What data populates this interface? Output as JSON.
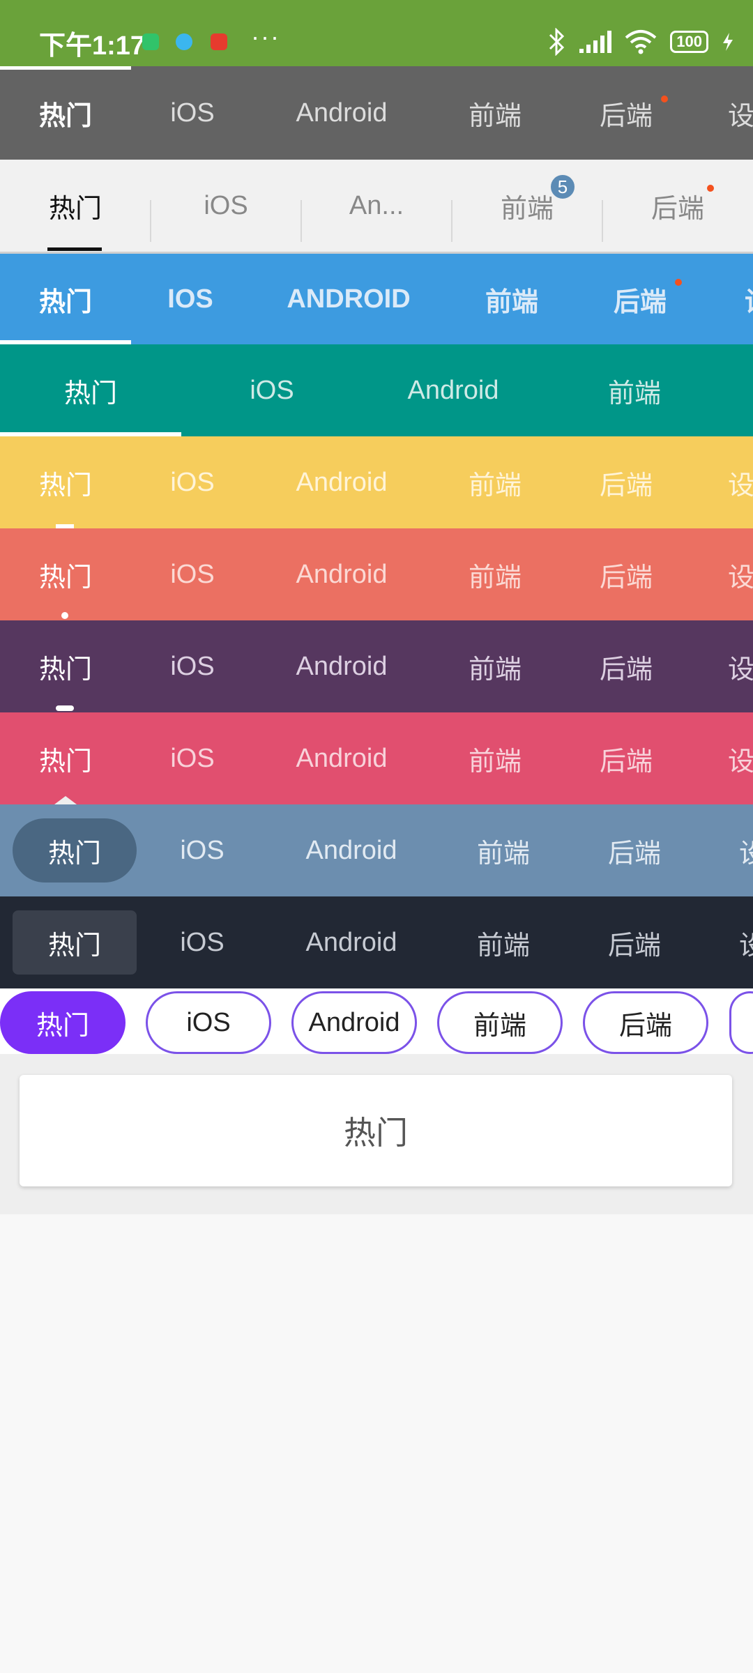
{
  "status_bar": {
    "time": "下午1:17",
    "more": "···",
    "battery": "100"
  },
  "tabs": [
    "热门",
    "iOS",
    "Android",
    "前端",
    "后端",
    "设"
  ],
  "tabs_truncated": [
    "热门",
    "iOS",
    "An...",
    "前端",
    "后端"
  ],
  "tabs_upper": [
    "热门",
    "IOS",
    "ANDROID",
    "前端",
    "后端",
    "设"
  ],
  "tabs_short": [
    "热门",
    "iOS",
    "Android",
    "前端"
  ],
  "badge_count": "5",
  "colors": {
    "status": "#6aa23a",
    "row1": "#636363",
    "row2": "#f1f1f1",
    "row3": "#3d9be0",
    "row4": "#009688",
    "row5": "#f6cd5c",
    "row6": "#eb7062",
    "row7": "#56375f",
    "row8": "#e14f6f",
    "row9": "#6c8eaf",
    "row10": "#222834",
    "chip_border": "#7b52e8",
    "chip_active": "#7b2ff7"
  },
  "content": {
    "title": "热门"
  }
}
